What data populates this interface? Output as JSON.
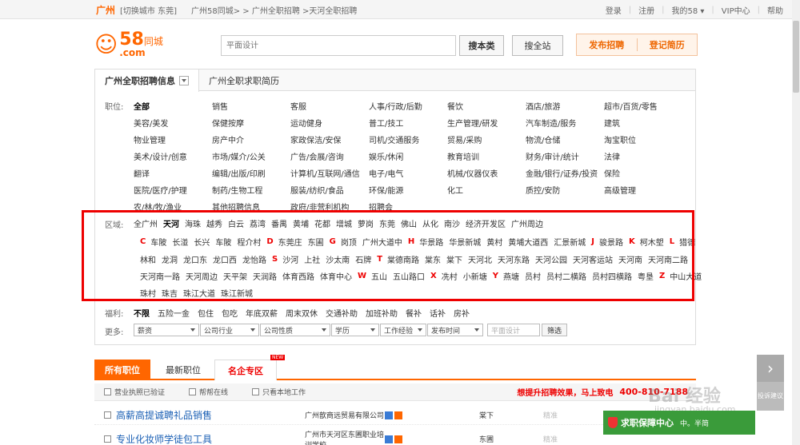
{
  "topbar": {
    "city": "广州",
    "switch_city": "[切换城市 东莞]",
    "breadcrumb": "广州58同城> > 广州全职招聘 >天河全职招聘",
    "nav": [
      "登录",
      "注册",
      "我的58 ▾",
      "VIP中心",
      "帮助"
    ],
    "nav_more": "▾"
  },
  "header": {
    "logo_58": "58",
    "logo_cn": "同城",
    "logo_com": ".com",
    "search_placeholder": "平面设计",
    "search_button": "搜本类",
    "search_all_button": "搜全站",
    "post_job": "发布招聘",
    "post_resume": "登记简历"
  },
  "tabs": {
    "active": "广州全职招聘信息",
    "other": "广州全职求职简历"
  },
  "position": {
    "label": "职位:",
    "rows": [
      [
        "全部",
        "销售",
        "客服",
        "人事/行政/后勤",
        "餐饮",
        "酒店/旅游",
        "超市/百货/零售"
      ],
      [
        "美容/美发",
        "保健按摩",
        "运动健身",
        "普工/技工",
        "生产管理/研发",
        "汽车制造/服务",
        "建筑"
      ],
      [
        "物业管理",
        "房产中介",
        "家政保洁/安保",
        "司机/交通服务",
        "贸易/采购",
        "物流/仓储",
        "淘宝职位"
      ],
      [
        "美术/设计/创意",
        "市场/媒介/公关",
        "广告/会展/咨询",
        "娱乐/休闲",
        "教育培训",
        "财务/审计/统计",
        "法律"
      ],
      [
        "翻译",
        "编辑/出版/印刷",
        "计算机/互联网/通信",
        "电子/电气",
        "机械/仪器仪表",
        "金融/银行/证券/投资",
        "保险"
      ],
      [
        "医院/医疗/护理",
        "制药/生物工程",
        "服装/纺织/食品",
        "环保/能源",
        "化工",
        "质控/安防",
        "高级管理"
      ],
      [
        "农/林/牧/渔业",
        "其他招聘信息",
        "政府/非营利机构",
        "招聘会"
      ]
    ]
  },
  "area": {
    "label": "区域:",
    "districts": [
      "全广州",
      "天河",
      "海珠",
      "越秀",
      "白云",
      "荔湾",
      "番禺",
      "黄埔",
      "花都",
      "增城",
      "萝岗",
      "东莞",
      "佛山",
      "从化",
      "南沙",
      "经济开发区",
      "广州周边"
    ],
    "sub_rows": [
      [
        [
          "C",
          [
            "车陂",
            "长湴",
            "长兴",
            "车陂",
            "程介村"
          ]
        ],
        [
          "D",
          [
            "东莞庄",
            "东圃"
          ]
        ],
        [
          "G",
          [
            "岗顶",
            "广州大道中"
          ]
        ],
        [
          "H",
          [
            "华景路",
            "华景新城",
            "黄村",
            "黄埔大道西",
            "汇景新城"
          ]
        ],
        [
          "J",
          [
            "骏景路"
          ]
        ],
        [
          "K",
          [
            "柯木塱"
          ]
        ],
        [
          "L",
          [
            "猎德"
          ]
        ]
      ],
      [
        [
          "",
          [
            "林和",
            "龙洞",
            "龙口东",
            "龙口西",
            "龙怡路"
          ]
        ],
        [
          "S",
          [
            "沙河",
            "上社",
            "沙太南",
            "石牌"
          ]
        ],
        [
          "T",
          [
            "棠德南路",
            "棠东",
            "棠下",
            "天河北",
            "天河东路",
            "天河公园",
            "天河客运站",
            "天河南",
            "天河南二路"
          ]
        ]
      ],
      [
        [
          "",
          [
            "天河南一路",
            "天河周边",
            "天平架",
            "天润路",
            "体育西路",
            "体育中心"
          ]
        ],
        [
          "W",
          [
            "五山",
            "五山路口"
          ]
        ],
        [
          "X",
          [
            "冼村",
            "小新塘"
          ]
        ],
        [
          "Y",
          [
            "燕塘",
            "员村",
            "员村二横路",
            "员村四横路",
            "粤垦"
          ]
        ],
        [
          "Z",
          [
            "中山大道"
          ]
        ]
      ],
      [
        [
          "",
          [
            "珠村",
            "珠吉",
            "珠江大道",
            "珠江新城"
          ]
        ]
      ]
    ]
  },
  "welfare": {
    "label": "福利:",
    "items": [
      "不限",
      "五险一金",
      "包住",
      "包吃",
      "年底双薪",
      "周末双休",
      "交通补助",
      "加班补助",
      "餐补",
      "话补",
      "房补"
    ]
  },
  "more": {
    "label": "更多:",
    "selects": [
      "薪资",
      "公司行业",
      "公司性质",
      "学历",
      "工作经验",
      "发布时间"
    ],
    "keyword_placeholder": "平面设计",
    "filter_button": "筛选"
  },
  "results": {
    "tabs": [
      "所有职位",
      "最新职位",
      "名企专区"
    ],
    "new_badge": "NEW",
    "options": [
      "营业执照已验证",
      "帮帮在线",
      "只看本地工作"
    ],
    "promo": "想提升招聘效果，马上致电",
    "phone": "400-810-7188",
    "jobs": [
      {
        "title": "高薪高提诚聘礼品销售",
        "company": "广州歆商远贸易有限公司",
        "location": "棠下",
        "tag": "精准"
      },
      {
        "title": "专业化妆师学徒包工具",
        "company": "广州市天河区东圃职业培训学校",
        "location": "东圃",
        "tag": "精准"
      }
    ]
  },
  "side": {
    "arrow": "›",
    "feedback": "投诉建议",
    "guarantee": "求职保障中心",
    "watermark": "Bai 经验",
    "watermark_url": "jingyan.baidu.com",
    "watermark_logo": "中。半简"
  },
  "colors": {
    "accent": "#ff6600",
    "highlight_border": "#ee0000",
    "link_blue": "#1a5fb4"
  }
}
